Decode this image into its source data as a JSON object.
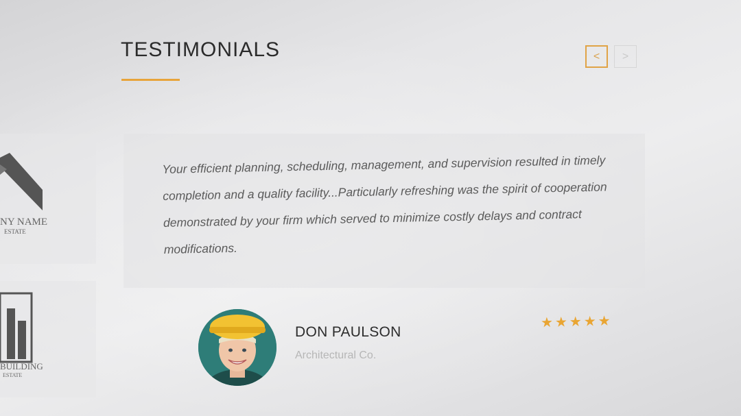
{
  "section": {
    "title": "TESTIMONIALS"
  },
  "nav": {
    "prev_label": "<",
    "next_label": ">"
  },
  "logos": [
    {
      "name": "NY NAME",
      "sub": "ESTATE"
    },
    {
      "name": "BUILDING",
      "sub": "ESTATE"
    }
  ],
  "testimonial": {
    "quote": "Your efficient planning, scheduling, management, and supervision resulted in timely completion and a quality facility...Particularly refreshing was the spirit of cooperation demonstrated by your firm which served to minimize costly delays and contract modifications.",
    "author_name": "DON PAULSON",
    "author_company": "Architectural Co.",
    "rating": 5,
    "stars": "★★★★★"
  },
  "colors": {
    "accent": "#e8a43a",
    "text": "#2b2b2b",
    "muted": "#b6b6b6"
  }
}
